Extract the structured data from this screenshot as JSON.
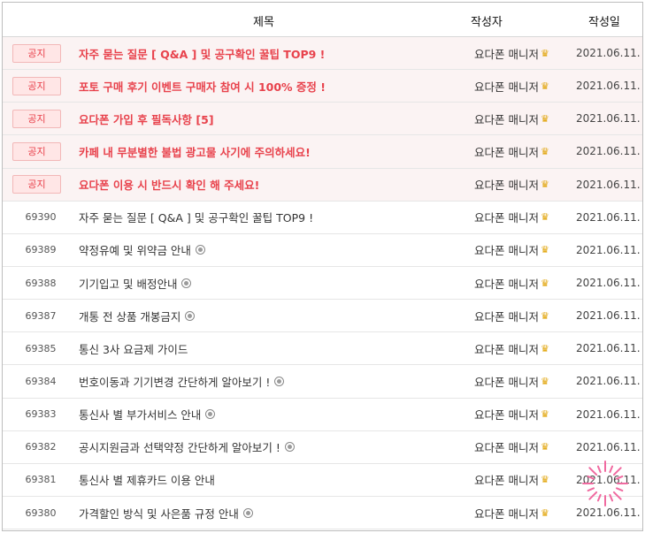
{
  "header": {
    "title": "제목",
    "author": "작성자",
    "date": "작성일"
  },
  "badge_label": "공지",
  "colors": {
    "notice_text": "#e8424c",
    "notice_row_bg": "#fbf3f3",
    "badge_bg": "#ffe6e6",
    "crown": "#e0a100"
  },
  "icons": {
    "crown": "crown-icon",
    "new_post": "moon-icon",
    "highlight": "sparkle-burst"
  },
  "rows": [
    {
      "notice": true,
      "num": "",
      "title": "자주 묻는 질문 [ Q&A ]  및 공구확인 꿀팁 TOP9 !",
      "icon": false,
      "author": "요다폰 매니저",
      "date": "2021.06.11."
    },
    {
      "notice": true,
      "num": "",
      "title": "포토 구매 후기 이벤트 구매자 참여 시 100% 증정 !",
      "icon": false,
      "author": "요다폰 매니저",
      "date": "2021.06.11."
    },
    {
      "notice": true,
      "num": "",
      "title": "요다폰 가입 후 필독사항 [5]",
      "icon": false,
      "author": "요다폰 매니저",
      "date": "2021.06.11."
    },
    {
      "notice": true,
      "num": "",
      "title": "카페 내 무분별한 불법 광고물 사기에 주의하세요!",
      "icon": false,
      "author": "요다폰 매니저",
      "date": "2021.06.11."
    },
    {
      "notice": true,
      "num": "",
      "title": "요다폰 이용 시 반드시 확인 해 주세요!",
      "icon": false,
      "author": "요다폰 매니저",
      "date": "2021.06.11."
    },
    {
      "notice": false,
      "num": "69390",
      "title": "자주 묻는 질문 [ Q&A ]  및 공구확인 꿀팁 TOP9 !",
      "icon": false,
      "author": "요다폰 매니저",
      "date": "2021.06.11."
    },
    {
      "notice": false,
      "num": "69389",
      "title": "약정유예 및 위약금 안내",
      "icon": true,
      "author": "요다폰 매니저",
      "date": "2021.06.11."
    },
    {
      "notice": false,
      "num": "69388",
      "title": "기기입고 및 배정안내",
      "icon": true,
      "author": "요다폰 매니저",
      "date": "2021.06.11."
    },
    {
      "notice": false,
      "num": "69387",
      "title": "개통 전 상품 개봉금지",
      "icon": true,
      "author": "요다폰 매니저",
      "date": "2021.06.11."
    },
    {
      "notice": false,
      "num": "69385",
      "title": "통신 3사 요금제 가이드",
      "icon": false,
      "author": "요다폰 매니저",
      "date": "2021.06.11."
    },
    {
      "notice": false,
      "num": "69384",
      "title": "번호이동과 기기변경 간단하게 알아보기 !",
      "icon": true,
      "author": "요다폰 매니저",
      "date": "2021.06.11."
    },
    {
      "notice": false,
      "num": "69383",
      "title": "통신사 별 부가서비스 안내",
      "icon": true,
      "author": "요다폰 매니저",
      "date": "2021.06.11."
    },
    {
      "notice": false,
      "num": "69382",
      "title": "공시지원금과 선택약정 간단하게 알아보기 !",
      "icon": true,
      "author": "요다폰 매니저",
      "date": "2021.06.11."
    },
    {
      "notice": false,
      "num": "69381",
      "title": "통신사 별 제휴카드 이용 안내",
      "icon": false,
      "author": "요다폰 매니저",
      "date": "2021.06.11."
    },
    {
      "notice": false,
      "num": "69380",
      "title": "가격할인 방식 및 사은품 규정 안내",
      "icon": true,
      "author": "요다폰 매니저",
      "date": "2021.06.11."
    }
  ]
}
